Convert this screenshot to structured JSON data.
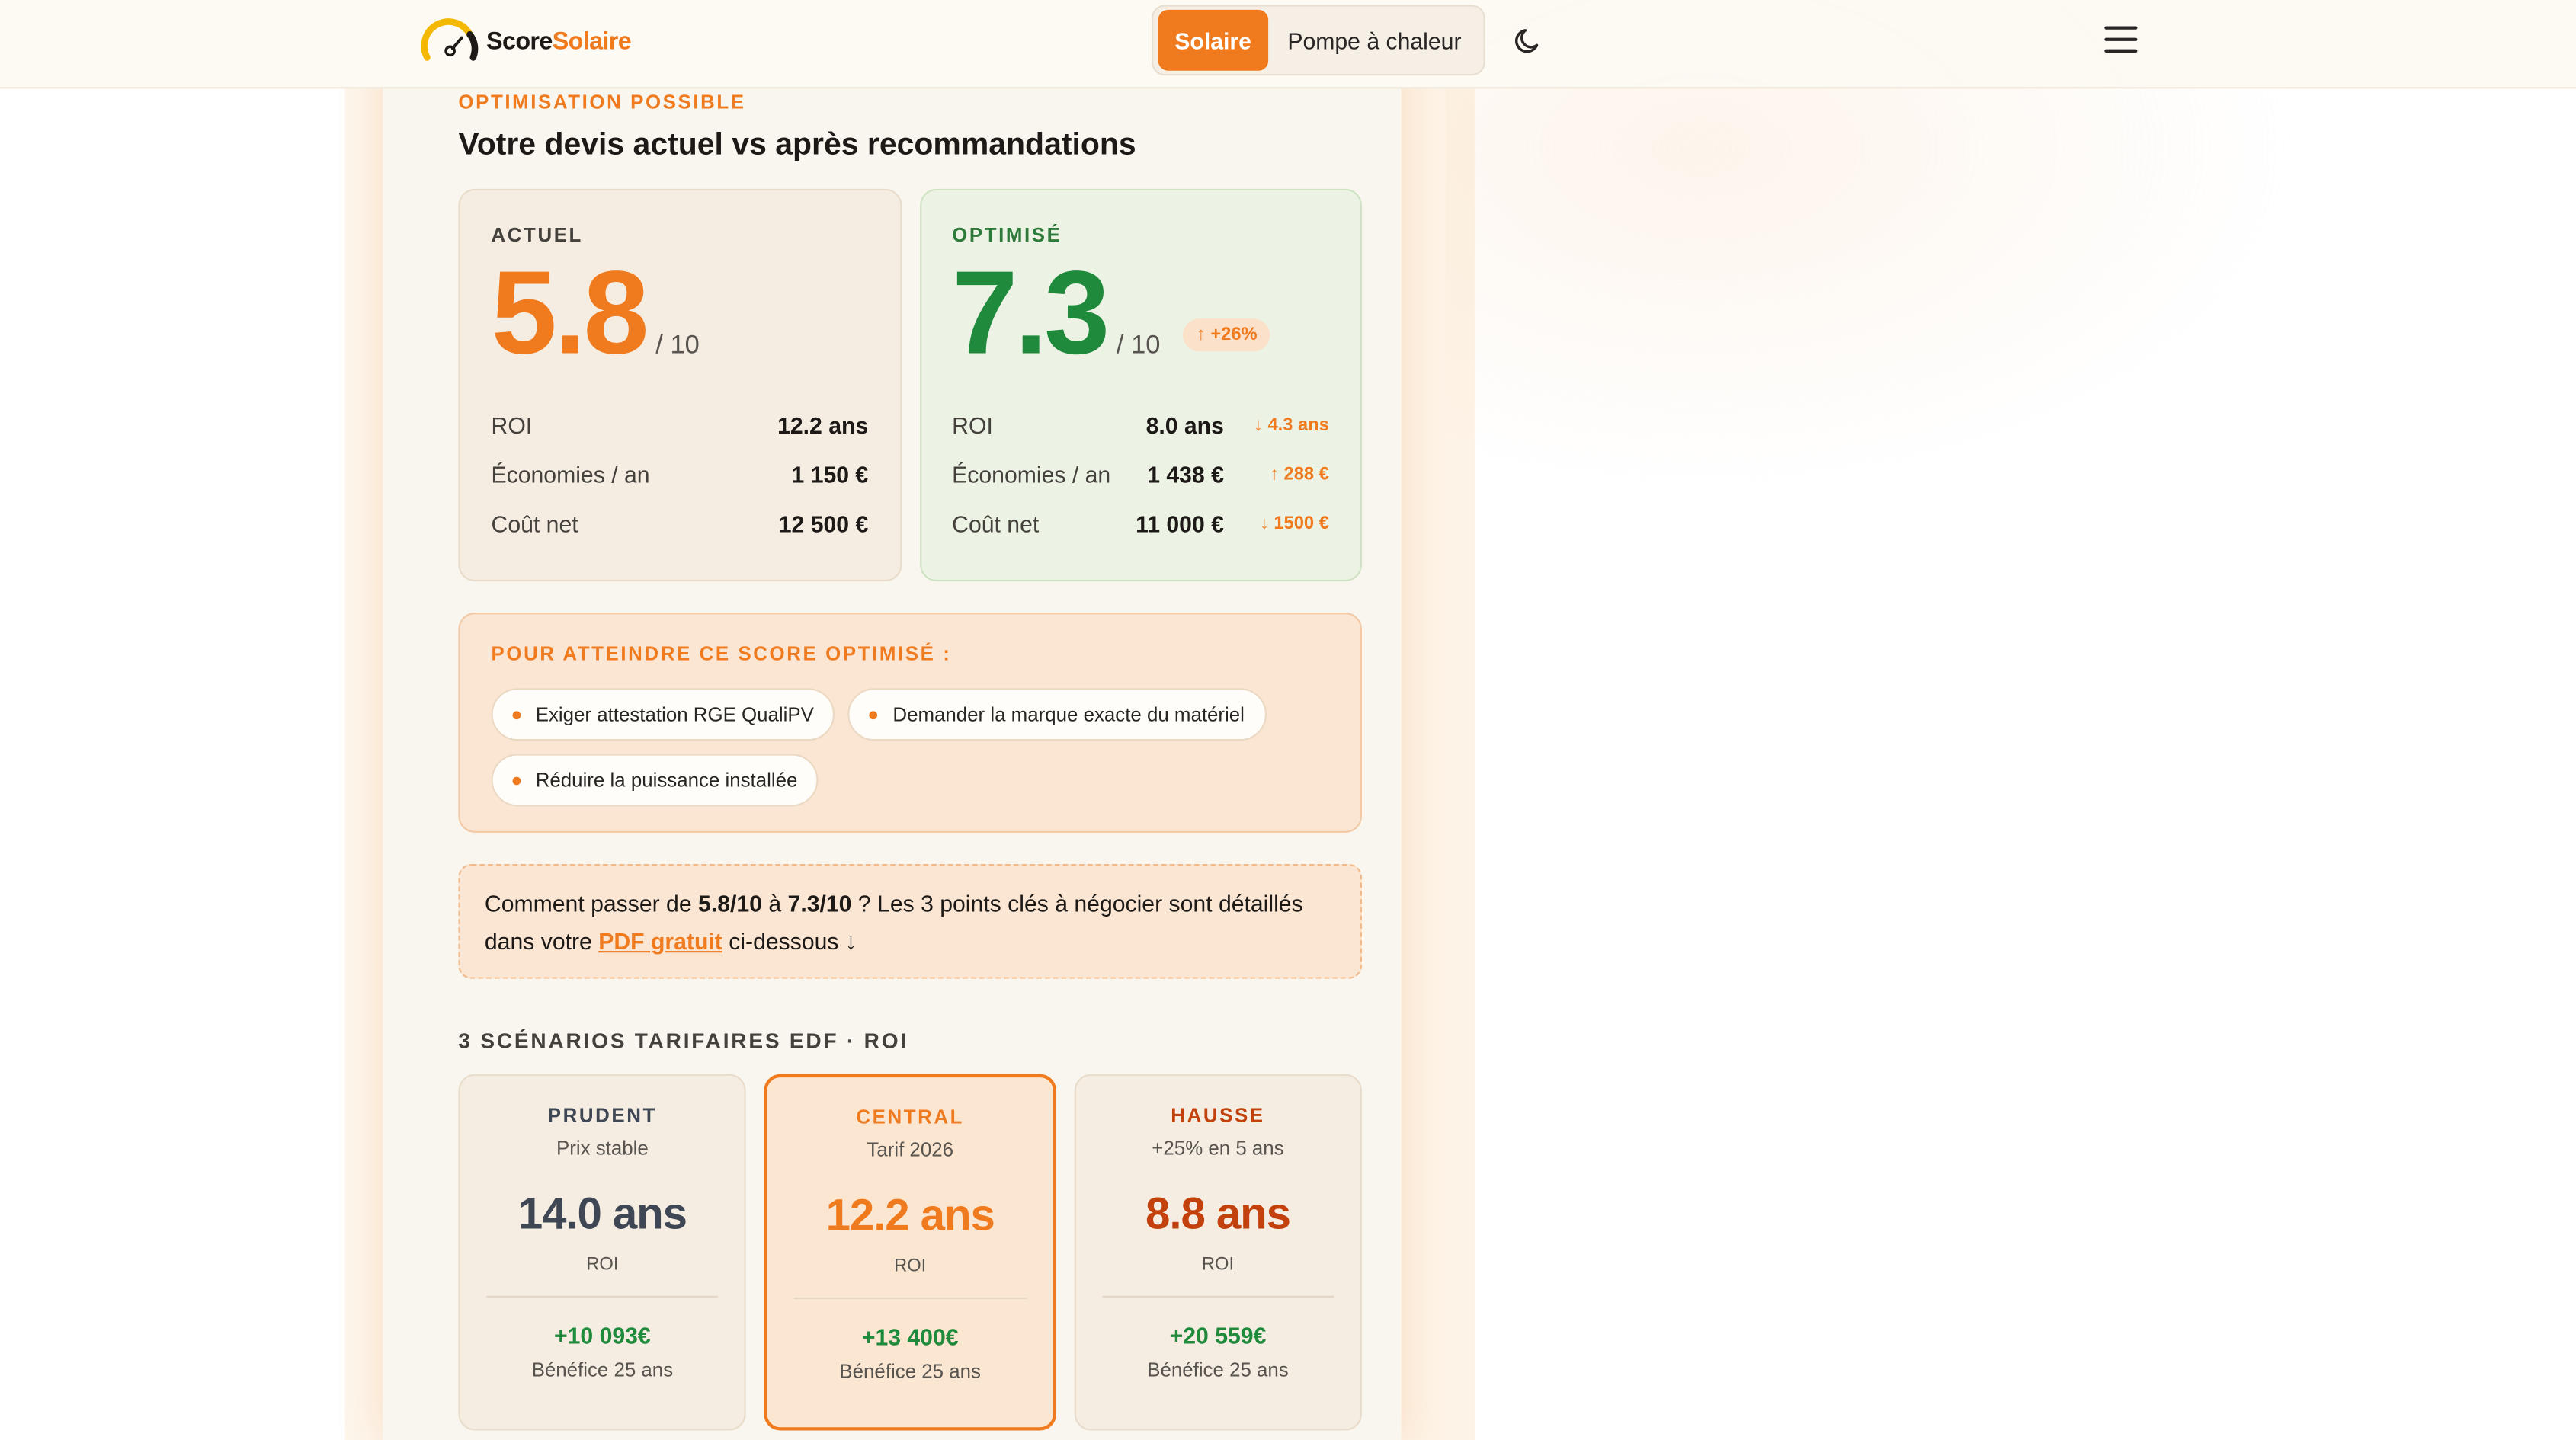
{
  "nav": {
    "logo_part1": "Score",
    "logo_part2": "Solaire",
    "tab_active": "Solaire",
    "tab_other": "Pompe à chaleur"
  },
  "header": {
    "eyebrow": "OPTIMISATION POSSIBLE",
    "title": "Votre devis actuel vs après recommandations"
  },
  "current": {
    "label": "ACTUEL",
    "score": "5.8",
    "out_of": "/ 10",
    "rows": [
      {
        "key": "ROI",
        "value": "12.2 ans"
      },
      {
        "key": "Économies / an",
        "value": "1 150 €"
      },
      {
        "key": "Coût net",
        "value": "12 500 €"
      }
    ]
  },
  "optimized": {
    "label": "OPTIMISÉ",
    "score": "7.3",
    "out_of": "/ 10",
    "delta": "↑ +26%",
    "rows": [
      {
        "key": "ROI",
        "value": "8.0 ans",
        "delta": "↓ 4.3 ans"
      },
      {
        "key": "Économies / an",
        "value": "1 438 €",
        "delta": "↑ 288 €"
      },
      {
        "key": "Coût net",
        "value": "11 000 €",
        "delta": "↓ 1500 €"
      }
    ]
  },
  "tips": {
    "label": "POUR ATTEINDRE CE SCORE OPTIMISÉ :",
    "items": [
      "Exiger attestation RGE QualiPV",
      "Demander la marque exacte du matériel",
      "Réduire la puissance installée"
    ]
  },
  "note": {
    "t1": "Comment passer de ",
    "b1": "5.8/10",
    "t2": " à ",
    "b2": "7.3/10",
    "t3": " ? Les 3 points clés à négocier sont détaillés dans votre ",
    "link": "PDF gratuit",
    "t4": " ci-dessous ↓"
  },
  "scenarios": {
    "title": "3 SCÉNARIOS TARIFAIRES EDF · ROI",
    "items": [
      {
        "name": "PRUDENT",
        "sub": "Prix stable",
        "value": "14.0 ans",
        "roi": "ROI",
        "gain": "+10 093€",
        "gain_label": "Bénéfice 25 ans"
      },
      {
        "name": "CENTRAL",
        "sub": "Tarif 2026",
        "value": "12.2 ans",
        "roi": "ROI",
        "gain": "+13 400€",
        "gain_label": "Bénéfice 25 ans"
      },
      {
        "name": "HAUSSE",
        "sub": "+25% en 5 ans",
        "value": "8.8 ans",
        "roi": "ROI",
        "gain": "+20 559€",
        "gain_label": "Bénéfice 25 ans"
      }
    ]
  },
  "colors": {
    "accent": "#f07a1e",
    "green": "#1f8a3c",
    "hausse": "#c2410c"
  }
}
